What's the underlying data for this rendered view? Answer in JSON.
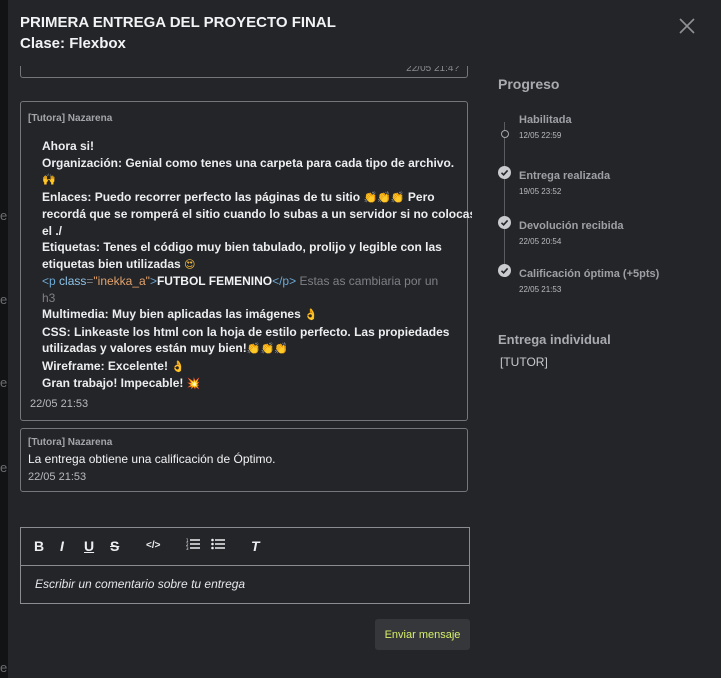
{
  "background_fragments": [
    "e",
    "e",
    "e",
    "e",
    "e"
  ],
  "modal": {
    "title": "PRIMERA ENTREGA DEL PROYECTO FINAL",
    "subtitle": "Clase: Flexbox",
    "close_icon": "close-icon"
  },
  "thread": {
    "previous_time": "22/05 21:4?",
    "messages": [
      {
        "author": "[Tutora] Nazarena",
        "lines": {
          "l1": "Ahora si!",
          "l2": "Organización: Genial como tenes una carpeta para cada tipo de archivo.",
          "l3_emoji": "🙌",
          "l4": "Enlaces: Puedo recorrer perfecto las páginas de tu sitio",
          "l4_emoji": "👏👏👏",
          "l4_tail": "Pero",
          "l5": "recordá que se romperá el sitio cuando lo subas a un servidor si no colocas",
          "l6": "el ./",
          "l7": "Etiquetas: Tenes el código muy bien tabulado, prolijo y legible con las",
          "l8": "etiquetas bien utilizadas",
          "l8_emoji": "😍",
          "code_open": "<p",
          "code_attr": "class",
          "code_eq": "=",
          "code_str": "\"inekka_a\"",
          "code_gt": ">",
          "code_text": "FUTBOL FEMENINO",
          "code_close": "</p>",
          "code_note": "Estas as cambiaria por un",
          "code_note2": "h3",
          "l10": "Multimedia: Muy bien aplicadas las imágenes",
          "l10_emoji": "👌",
          "l11": "CSS: Linkeaste los html con la hoja de estilo perfecto. Las propiedades",
          "l12": "utilizadas y valores están muy bien!",
          "l12_emoji": "👏👏👏",
          "l13": "Wireframe: Excelente!",
          "l13_emoji": "👌",
          "l14": "Gran trabajo! Impecable!",
          "l14_emoji": "💥"
        },
        "time": "22/05 21:53"
      },
      {
        "author": "[Tutora] Nazarena",
        "body": "La entrega obtiene una calificación de Óptimo.",
        "time": "22/05 21:53"
      }
    ]
  },
  "editor": {
    "toolbar": {
      "bold": "B",
      "italic": "I",
      "underline": "U",
      "strike": "S",
      "code": "</>",
      "ordered_list": "ordered-list-icon",
      "bullet_list": "bullet-list-icon",
      "clear_format": "T"
    },
    "placeholder": "Escribir un comentario sobre tu entrega"
  },
  "send_button": "Enviar mensaje",
  "progress": {
    "title": "Progreso",
    "steps": [
      {
        "label": "Habilitada",
        "date": "12/05 22:59",
        "done": false
      },
      {
        "label": "Entrega realizada",
        "date": "19/05 23:52",
        "done": true
      },
      {
        "label": "Devolución recibida",
        "date": "22/05 20:54",
        "done": true
      },
      {
        "label": "Calificación óptima (+5pts)",
        "date": "22/05 21:53",
        "done": true
      }
    ]
  },
  "individual": {
    "title": "Entrega individual",
    "value": "[TUTOR]"
  },
  "colors": {
    "accent": "#d7f06a",
    "modal_bg": "#242528",
    "border": "#74767b"
  }
}
